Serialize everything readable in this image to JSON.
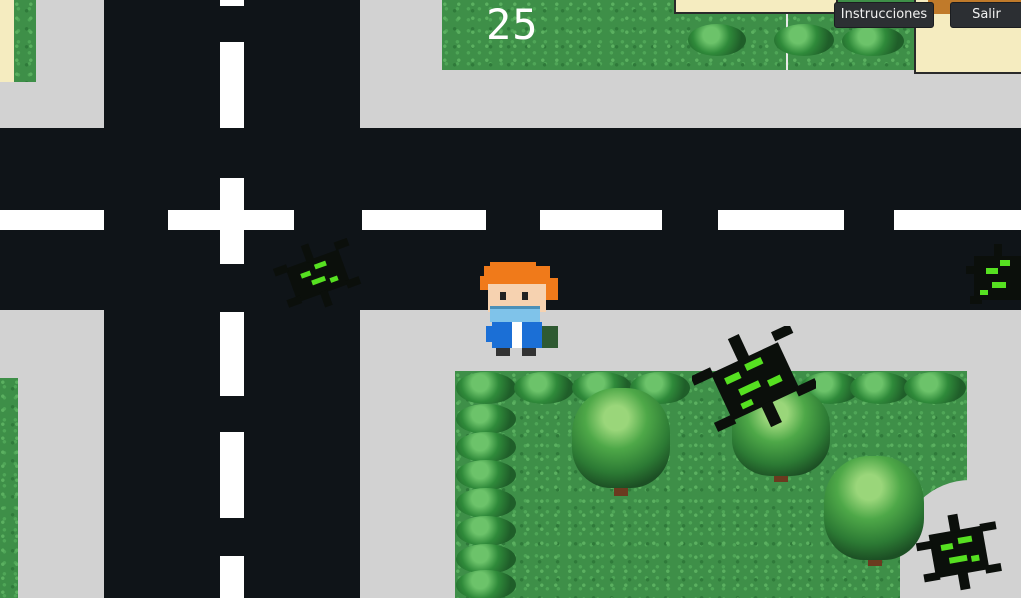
{
  "hud": {
    "score": "25",
    "instructions_label": "Instrucciones",
    "exit_label": "Salir"
  },
  "colors": {
    "road": "#0f1418",
    "lane_marking": "#ffffff",
    "sidewalk": "#d2d2d2",
    "grass": "#3e8f48",
    "virus_body": "#0b0f0b",
    "virus_glow": "#56e021",
    "player_hair": "#f07a1a",
    "player_mask": "#7fc3ea",
    "player_jacket": "#1b6fd6"
  },
  "entities": {
    "player": "player-character",
    "enemies": [
      "virus",
      "virus",
      "virus",
      "virus"
    ],
    "trees": [
      "tree",
      "tree",
      "tree",
      "tree"
    ]
  }
}
